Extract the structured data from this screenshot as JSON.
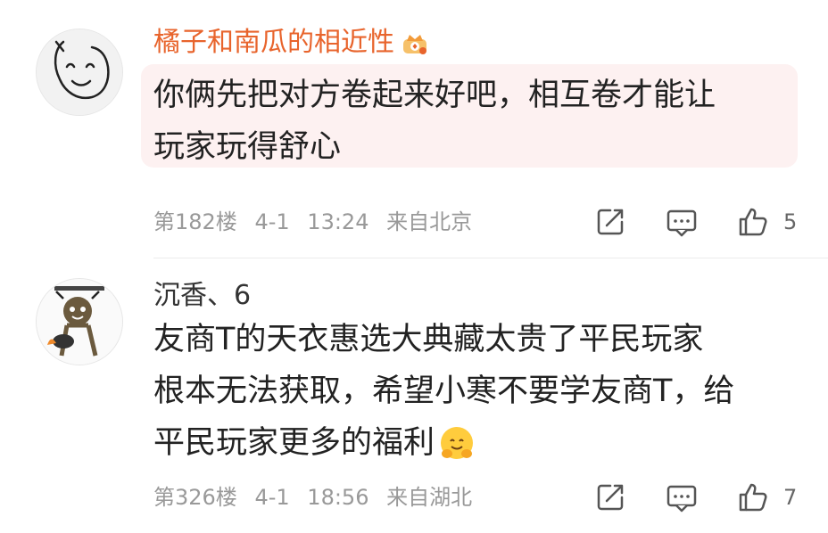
{
  "comments": [
    {
      "username": "橘子和南瓜的相近性",
      "badge_icon": "crown-level-badge-icon",
      "content_lines": [
        "你俩先把对方卷起来好吧，相互卷才能让",
        "玩家玩得舒心"
      ],
      "floor": "第182楼",
      "date": "4-1",
      "time": "13:24",
      "location": "来自北京",
      "likes": "5",
      "username_color": "#e8642c"
    },
    {
      "username": "沉香、6",
      "content_lines": [
        "友商T的天衣惠选大典藏太贵了平民玩家",
        "根本无法获取，希望小寒不要学友商T，给",
        "平民玩家更多的福利"
      ],
      "emoji": "hugging-face-emoji",
      "floor": "第326楼",
      "date": "4-1",
      "time": "18:56",
      "location": "来自湖北",
      "likes": "7"
    }
  ],
  "colors": {
    "accent_orange": "#e8642c",
    "bubble_pink": "#fdf1f1",
    "meta_gray": "#999999"
  }
}
